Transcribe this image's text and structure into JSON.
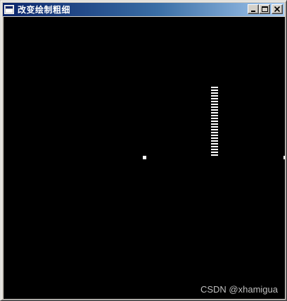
{
  "window": {
    "title": "改变绘制粗细",
    "icon": "window-app-icon",
    "buttons": {
      "minimize_icon": "minimize-icon",
      "maximize_icon": "maximize-icon",
      "close_icon": "close-icon"
    }
  },
  "canvas": {
    "background": "#000000",
    "foreground": "#ffffff",
    "watermark": "CSDN @xhamigua"
  },
  "colors": {
    "titlebar_start": "#0a246a",
    "titlebar_end": "#a6caf0",
    "chrome": "#d4d0c8"
  }
}
